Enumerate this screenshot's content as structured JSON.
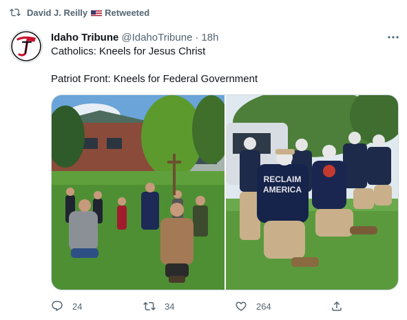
{
  "retweet": {
    "name": "David J. Reilly",
    "flag_icon": "us-flag-icon",
    "label": "Retweeted"
  },
  "author": {
    "name": "Idaho Tribune",
    "handle": "@IdahoTribune",
    "separator": "·",
    "time": "18h",
    "logo_icon": "idaho-tribune-logo"
  },
  "tweet": {
    "line1": "Catholics: Kneels for Jesus Christ",
    "line2": "Patriot Front: Kneels for Federal Government",
    "photo_shirt_text": [
      "RECLAIM",
      "AMERICA"
    ]
  },
  "actions": {
    "replies": "24",
    "retweets": "34",
    "likes": "264"
  },
  "colors": {
    "secondary_text": "#536471",
    "border": "#cfd9de",
    "logo_red": "#c8102e"
  }
}
